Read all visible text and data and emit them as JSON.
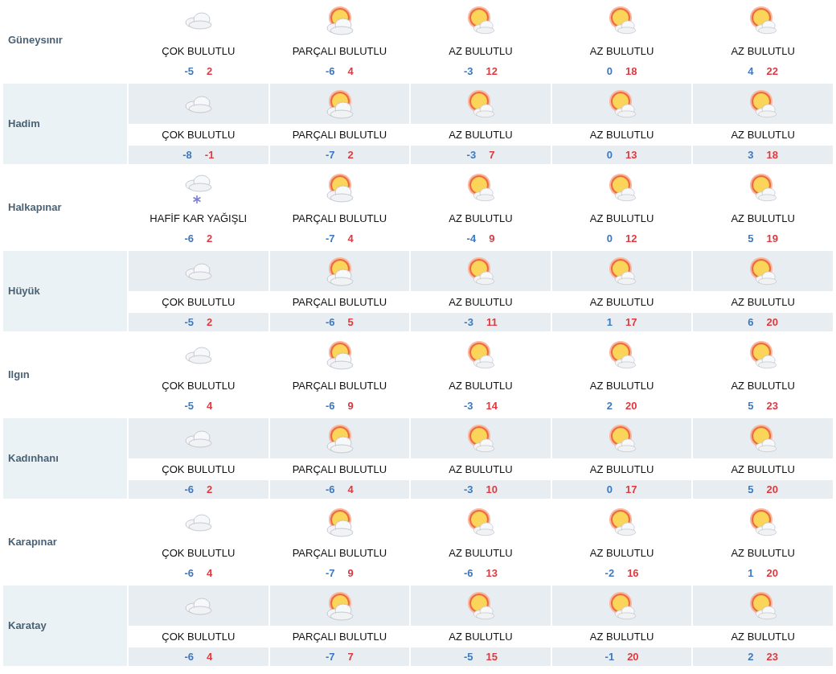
{
  "rows": [
    {
      "name": "Güneysınır",
      "days": [
        {
          "kind": "cloudy",
          "condition": "ÇOK BULUTLU",
          "min": "-5",
          "max": "2"
        },
        {
          "kind": "partly_cloudy",
          "condition": "PARÇALI BULUTLU",
          "min": "-6",
          "max": "4"
        },
        {
          "kind": "mostly_sunny",
          "condition": "AZ BULUTLU",
          "min": "-3",
          "max": "12"
        },
        {
          "kind": "mostly_sunny",
          "condition": "AZ BULUTLU",
          "min": "0",
          "max": "18"
        },
        {
          "kind": "mostly_sunny",
          "condition": "AZ BULUTLU",
          "min": "4",
          "max": "22"
        }
      ]
    },
    {
      "name": "Hadim",
      "days": [
        {
          "kind": "cloudy",
          "condition": "ÇOK BULUTLU",
          "min": "-8",
          "max": "-1"
        },
        {
          "kind": "partly_cloudy",
          "condition": "PARÇALI BULUTLU",
          "min": "-7",
          "max": "2"
        },
        {
          "kind": "mostly_sunny",
          "condition": "AZ BULUTLU",
          "min": "-3",
          "max": "7"
        },
        {
          "kind": "mostly_sunny",
          "condition": "AZ BULUTLU",
          "min": "0",
          "max": "13"
        },
        {
          "kind": "mostly_sunny",
          "condition": "AZ BULUTLU",
          "min": "3",
          "max": "18"
        }
      ]
    },
    {
      "name": "Halkapınar",
      "days": [
        {
          "kind": "snow",
          "condition": "HAFİF KAR YAĞIŞLI",
          "min": "-6",
          "max": "2"
        },
        {
          "kind": "partly_cloudy",
          "condition": "PARÇALI BULUTLU",
          "min": "-7",
          "max": "4"
        },
        {
          "kind": "mostly_sunny",
          "condition": "AZ BULUTLU",
          "min": "-4",
          "max": "9"
        },
        {
          "kind": "mostly_sunny",
          "condition": "AZ BULUTLU",
          "min": "0",
          "max": "12"
        },
        {
          "kind": "mostly_sunny",
          "condition": "AZ BULUTLU",
          "min": "5",
          "max": "19"
        }
      ]
    },
    {
      "name": "Hüyük",
      "days": [
        {
          "kind": "cloudy",
          "condition": "ÇOK BULUTLU",
          "min": "-5",
          "max": "2"
        },
        {
          "kind": "partly_cloudy",
          "condition": "PARÇALI BULUTLU",
          "min": "-6",
          "max": "5"
        },
        {
          "kind": "mostly_sunny",
          "condition": "AZ BULUTLU",
          "min": "-3",
          "max": "11"
        },
        {
          "kind": "mostly_sunny",
          "condition": "AZ BULUTLU",
          "min": "1",
          "max": "17"
        },
        {
          "kind": "mostly_sunny",
          "condition": "AZ BULUTLU",
          "min": "6",
          "max": "20"
        }
      ]
    },
    {
      "name": "Ilgın",
      "days": [
        {
          "kind": "cloudy",
          "condition": "ÇOK BULUTLU",
          "min": "-5",
          "max": "4"
        },
        {
          "kind": "partly_cloudy",
          "condition": "PARÇALI BULUTLU",
          "min": "-6",
          "max": "9"
        },
        {
          "kind": "mostly_sunny",
          "condition": "AZ BULUTLU",
          "min": "-3",
          "max": "14"
        },
        {
          "kind": "mostly_sunny",
          "condition": "AZ BULUTLU",
          "min": "2",
          "max": "20"
        },
        {
          "kind": "mostly_sunny",
          "condition": "AZ BULUTLU",
          "min": "5",
          "max": "23"
        }
      ]
    },
    {
      "name": "Kadınhanı",
      "days": [
        {
          "kind": "cloudy",
          "condition": "ÇOK BULUTLU",
          "min": "-6",
          "max": "2"
        },
        {
          "kind": "partly_cloudy",
          "condition": "PARÇALI BULUTLU",
          "min": "-6",
          "max": "4"
        },
        {
          "kind": "mostly_sunny",
          "condition": "AZ BULUTLU",
          "min": "-3",
          "max": "10"
        },
        {
          "kind": "mostly_sunny",
          "condition": "AZ BULUTLU",
          "min": "0",
          "max": "17"
        },
        {
          "kind": "mostly_sunny",
          "condition": "AZ BULUTLU",
          "min": "5",
          "max": "20"
        }
      ]
    },
    {
      "name": "Karapınar",
      "days": [
        {
          "kind": "cloudy",
          "condition": "ÇOK BULUTLU",
          "min": "-6",
          "max": "4"
        },
        {
          "kind": "partly_cloudy",
          "condition": "PARÇALI BULUTLU",
          "min": "-7",
          "max": "9"
        },
        {
          "kind": "mostly_sunny",
          "condition": "AZ BULUTLU",
          "min": "-6",
          "max": "13"
        },
        {
          "kind": "mostly_sunny",
          "condition": "AZ BULUTLU",
          "min": "-2",
          "max": "16"
        },
        {
          "kind": "mostly_sunny",
          "condition": "AZ BULUTLU",
          "min": "1",
          "max": "20"
        }
      ]
    },
    {
      "name": "Karatay",
      "days": [
        {
          "kind": "cloudy",
          "condition": "ÇOK BULUTLU",
          "min": "-6",
          "max": "4"
        },
        {
          "kind": "partly_cloudy",
          "condition": "PARÇALI BULUTLU",
          "min": "-7",
          "max": "7"
        },
        {
          "kind": "mostly_sunny",
          "condition": "AZ BULUTLU",
          "min": "-5",
          "max": "15"
        },
        {
          "kind": "mostly_sunny",
          "condition": "AZ BULUTLU",
          "min": "-1",
          "max": "20"
        },
        {
          "kind": "mostly_sunny",
          "condition": "AZ BULUTLU",
          "min": "2",
          "max": "23"
        }
      ]
    }
  ]
}
